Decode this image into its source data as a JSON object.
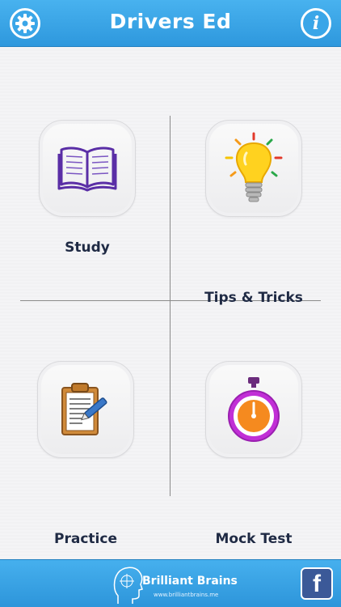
{
  "header": {
    "title": "Drivers Ed",
    "left_icon": "gear-icon",
    "right_icon": "info-icon",
    "info_glyph": "i"
  },
  "tiles": [
    {
      "label": "Study",
      "icon": "book-icon",
      "color": "#5a2ea6"
    },
    {
      "label": "Tips & Tricks",
      "icon": "lightbulb-icon",
      "color": "#f5c400"
    },
    {
      "label": "Practice",
      "icon": "clipboard-icon",
      "color": "#b5651d"
    },
    {
      "label": "Mock Test",
      "icon": "stopwatch-icon",
      "color": "#c12fd6"
    }
  ],
  "footer": {
    "brand_name": "Brilliant Brains",
    "brand_url": "www.brilliantbrains.me",
    "facebook_glyph": "f"
  },
  "colors": {
    "header_blue": "#3aa6e8",
    "title_text": "#1f2a44",
    "facebook": "#3b5998"
  }
}
